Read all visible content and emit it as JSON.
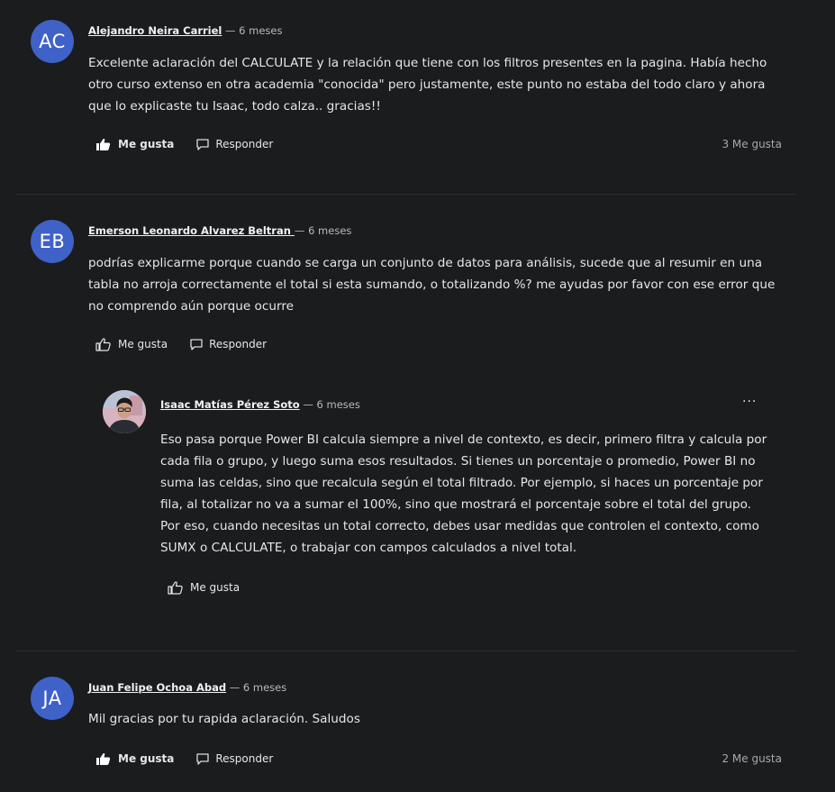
{
  "comments": [
    {
      "initials": "AC",
      "author": "Alejandro Neira Carriel",
      "time": "— 6 meses",
      "text": "Excelente aclaración del CALCULATE y la relación que tiene con los filtros presentes en la pagina. Había hecho otro curso extenso en otra academia \"conocida\" pero justamente, este punto no estaba del todo claro y ahora que lo explicaste tu Isaac, todo calza.. gracias!!",
      "like_label": "Me gusta",
      "reply_label": "Responder",
      "likes_count": "3 Me gusta",
      "liked": true
    },
    {
      "initials": "EB",
      "author": "Emerson Leonardo Alvarez Beltran ",
      "time": "— 6 meses",
      "text": "podrías explicarme porque cuando se carga un conjunto de datos para análisis, sucede que al resumir en una tabla no arroja correctamente el total si esta sumando, o totalizando %? me ayudas por favor con ese error que no comprendo aún porque ocurre",
      "like_label": "Me gusta",
      "reply_label": "Responder",
      "liked": false,
      "reply": {
        "author": "Isaac Matías Pérez Soto",
        "time": "— 6 meses",
        "more_label": "···",
        "text": "Eso pasa porque Power BI calcula siempre a nivel de contexto, es decir, primero filtra y calcula por cada fila o grupo, y luego suma esos resultados. Si tienes un porcentaje o promedio, Power BI no suma las celdas, sino que recalcula según el total filtrado. Por ejemplo, si haces un porcentaje por fila, al totalizar no va a sumar el 100%, sino que mostrará el porcentaje sobre el total del grupo. Por eso, cuando necesitas un total correcto, debes usar medidas que controlen el contexto, como SUMX o CALCULATE, o trabajar con campos calculados a nivel total.",
        "like_label": "Me gusta",
        "liked": false
      }
    },
    {
      "initials": "JA",
      "author": "Juan Felipe Ochoa Abad",
      "time": "— 6 meses",
      "text": "Mil gracias por tu rapida aclaración. Saludos",
      "like_label": "Me gusta",
      "reply_label": "Responder",
      "likes_count": "2 Me gusta",
      "liked": true
    }
  ],
  "colors": {
    "background": "#1a1c1e",
    "avatar": "#3f62c8",
    "divider": "#2c2f33"
  }
}
